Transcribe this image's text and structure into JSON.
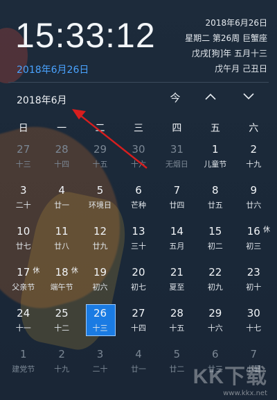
{
  "header": {
    "time": "15:33:12",
    "date_link": "2018年6月26日",
    "info": [
      "2018年6月26日",
      "星期二 第26周 巨蟹座",
      "戊戌[狗]年 五月十三",
      "戊午月 己丑日"
    ]
  },
  "calendar": {
    "month_title": "2018年6月",
    "nav": {
      "today": "今",
      "prev_icon": "chevron-up-icon",
      "next_icon": "chevron-down-icon"
    },
    "weekdays": [
      "日",
      "一",
      "二",
      "三",
      "四",
      "五",
      "六"
    ],
    "weeks": [
      [
        {
          "n": "27",
          "l": "十三",
          "other": true
        },
        {
          "n": "28",
          "l": "十四",
          "other": true
        },
        {
          "n": "29",
          "l": "十五",
          "other": true
        },
        {
          "n": "30",
          "l": "十六",
          "other": true
        },
        {
          "n": "31",
          "l": "无烟日",
          "other": true
        },
        {
          "n": "1",
          "l": "儿童节"
        },
        {
          "n": "2",
          "l": "十九"
        }
      ],
      [
        {
          "n": "3",
          "l": "二十"
        },
        {
          "n": "4",
          "l": "廿一"
        },
        {
          "n": "5",
          "l": "环境日"
        },
        {
          "n": "6",
          "l": "芒种"
        },
        {
          "n": "7",
          "l": "廿四"
        },
        {
          "n": "8",
          "l": "廿五"
        },
        {
          "n": "9",
          "l": "廿六"
        }
      ],
      [
        {
          "n": "10",
          "l": "廿七"
        },
        {
          "n": "11",
          "l": "廿八"
        },
        {
          "n": "12",
          "l": "廿九"
        },
        {
          "n": "13",
          "l": "三十"
        },
        {
          "n": "14",
          "l": "五月"
        },
        {
          "n": "15",
          "l": "初二"
        },
        {
          "n": "16",
          "l": "初三",
          "tag": "休"
        }
      ],
      [
        {
          "n": "17",
          "l": "父亲节",
          "tag": "休"
        },
        {
          "n": "18",
          "l": "端午节",
          "tag": "休"
        },
        {
          "n": "19",
          "l": "初六"
        },
        {
          "n": "20",
          "l": "初七"
        },
        {
          "n": "21",
          "l": "夏至"
        },
        {
          "n": "22",
          "l": "初九"
        },
        {
          "n": "23",
          "l": "初十"
        }
      ],
      [
        {
          "n": "24",
          "l": "十一"
        },
        {
          "n": "25",
          "l": "十二"
        },
        {
          "n": "26",
          "l": "十三",
          "today": true
        },
        {
          "n": "27",
          "l": "十四"
        },
        {
          "n": "28",
          "l": "十五"
        },
        {
          "n": "29",
          "l": "十六"
        },
        {
          "n": "30",
          "l": "十七"
        }
      ],
      [
        {
          "n": "1",
          "l": "建党节",
          "other": true
        },
        {
          "n": "2",
          "l": "十九",
          "other": true
        },
        {
          "n": "3",
          "l": "二十",
          "other": true
        },
        {
          "n": "4",
          "l": "廿一",
          "other": true
        },
        {
          "n": "5",
          "l": "廿二",
          "other": true
        },
        {
          "n": "6",
          "l": "廿三",
          "other": true
        },
        {
          "n": "7",
          "l": "小暑",
          "other": true
        }
      ]
    ]
  },
  "annotation": {
    "arrow_color": "#d81e1e"
  },
  "watermark": {
    "logo": "KK下载",
    "url": "www.kkx.net"
  },
  "colors": {
    "accent": "#1a7be3",
    "link": "#4aa3ff",
    "background": "#1c2a3a"
  }
}
